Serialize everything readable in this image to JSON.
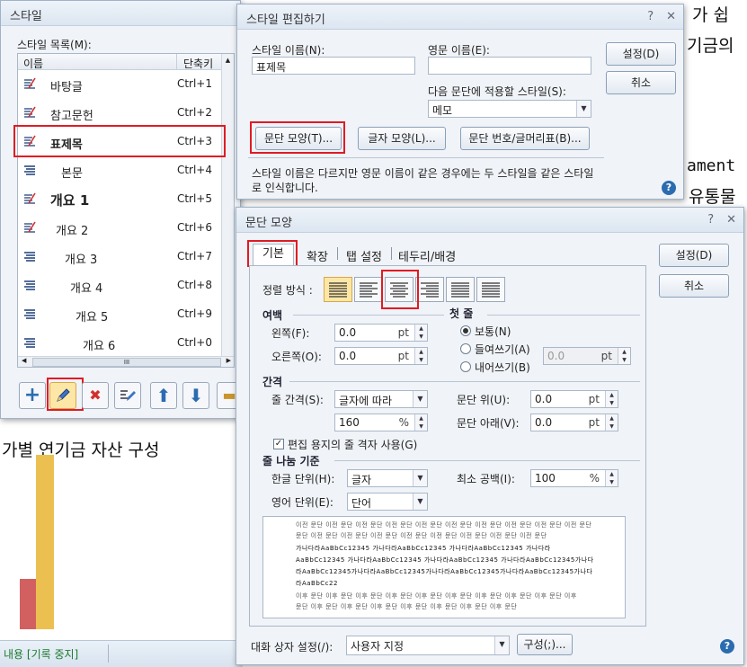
{
  "background_doc": {
    "right_snippets": [
      "가 쉽",
      "기금의",
      "ament",
      "유통물"
    ],
    "chart_title_fragment": "가별 연기금 자산 구성",
    "status_bar": "내용 [기록 중지]"
  },
  "style_window": {
    "title": "스타일",
    "list_label": "스타일 목록(M):",
    "col_name": "이름",
    "col_shortcut": "단축키",
    "items": [
      {
        "name": "바탕글",
        "shortcut": "Ctrl+1"
      },
      {
        "name": "참고문헌",
        "shortcut": "Ctrl+2"
      },
      {
        "name": "표제목",
        "shortcut": "Ctrl+3"
      },
      {
        "name": "본문",
        "shortcut": "Ctrl+4"
      },
      {
        "name": "개요 1",
        "shortcut": "Ctrl+5"
      },
      {
        "name": "개요 2",
        "shortcut": "Ctrl+6"
      },
      {
        "name": "개요 3",
        "shortcut": "Ctrl+7"
      },
      {
        "name": "개요 4",
        "shortcut": "Ctrl+8"
      },
      {
        "name": "개요 5",
        "shortcut": "Ctrl+9"
      },
      {
        "name": "개요 6",
        "shortcut": "Ctrl+0"
      }
    ],
    "scroll_mid": "III"
  },
  "edit_dialog": {
    "title": "스타일 편집하기",
    "help": "?",
    "close": "✕",
    "style_name_label": "스타일 이름(N):",
    "style_name_value": "표제목",
    "english_name_label": "영문 이름(E):",
    "english_name_value": "",
    "next_style_label": "다음 문단에 적용할 스타일(S):",
    "next_style_value": "메모",
    "btn_paragraph": "문단 모양(T)...",
    "btn_char": "글자 모양(L)...",
    "btn_numbering": "문단 번호/글머리표(B)...",
    "btn_ok": "설정(D)",
    "btn_cancel": "취소",
    "note": "스타일 이름은 다르지만 영문 이름이 같은 경우에는 두 스타일을 같은 스타일로 인식합니다."
  },
  "para_dialog": {
    "title": "문단 모양",
    "help": "?",
    "close": "✕",
    "tabs": [
      "기본",
      "확장",
      "탭 설정",
      "테두리/배경"
    ],
    "btn_ok": "설정(D)",
    "btn_cancel": "취소",
    "align_label": "정렬 방식 :",
    "margin_title": "여백",
    "left_label": "왼쪽(F):",
    "left_value": "0.0",
    "right_label": "오른쪽(O):",
    "right_value": "0.0",
    "unit_pt": "pt",
    "first_line_title": "첫 줄",
    "radio_normal": "보통(N)",
    "radio_indent": "들여쓰기(A)",
    "radio_outdent": "내어쓰기(B)",
    "indent_value": "0.0",
    "spacing_title": "간격",
    "line_spacing_label": "줄 간격(S):",
    "line_spacing_type": "글자에 따라",
    "line_spacing_value": "160",
    "unit_pct": "%",
    "para_above_label": "문단 위(U):",
    "para_above_value": "0.0",
    "para_below_label": "문단 아래(V):",
    "para_below_value": "0.0",
    "grid_check_label": "편집 용지의 줄 격자 사용(G)",
    "linebreak_title": "줄 나눔 기준",
    "korean_unit_label": "한글 단위(H):",
    "korean_unit_value": "글자",
    "english_unit_label": "영어 단위(E):",
    "english_unit_value": "단어",
    "min_space_label": "최소 공백(I):",
    "min_space_value": "100",
    "preview": {
      "prev_lines": [
        "이전 문단 이전 문단 이전 문단 이전 문단 이전 문단 이전 문단 이전 문단 이전 문단 이전 문단 이전 문단",
        "문단 이전 문단 이전 문단 이전 문단 이전 문단 이전 문단 이전 문단 이전 문단 이전 문단"
      ],
      "cur_lines": [
        "가나다라AaBbCc12345    가나다라AaBbCc12345    가나다라AaBbCc12345    가나다라",
        "AaBbCc12345  가나다라AaBbCc12345  가나다라AaBbCc12345  가나다라AaBbCc12345가나다",
        "라AaBbCc12345가나다라AaBbCc12345가나다라AaBbCc12345가나다라AaBbCc12345가나다",
        "라AaBbCc22"
      ],
      "next_lines": [
        "이후 문단 이후 문단 이후 문단 이후 문단 이후 문단 이후 문단 이후 문단 이후 문단 이후 문단 이후",
        "문단 이후 문단 이후 문단 이후 문단 이후 문단 이후 문단 이후 문단 이후 문단"
      ]
    },
    "dialog_setting_label": "대화 상자 설정(/):",
    "dialog_setting_value": "사용자 지정",
    "btn_config": "구성(;)...",
    "dialog_help_icon": "?"
  },
  "colors": {
    "highlight_red": "#e01b24",
    "accent_blue": "#2b6cb0",
    "chart_orange": "#ecc050",
    "chart_red": "#d26060"
  }
}
